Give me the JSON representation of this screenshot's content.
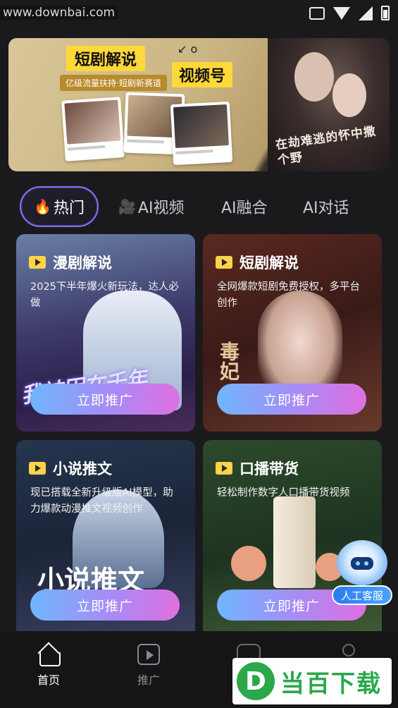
{
  "status_bar": {
    "watermark": "www.downbai.com",
    "icons": [
      "vibrate-icon",
      "wifi-icon",
      "signal-icon",
      "battery-icon"
    ]
  },
  "banner": {
    "title": "短剧解说",
    "title2": "视频号",
    "subtitle": "亿级流量扶持·短剧新赛道",
    "calligraphy": "在劫难逃的怀中撒个野",
    "colors": {
      "yellow": "#ffd83a",
      "gold": "#b88a2b"
    }
  },
  "tabs": [
    {
      "label": "热门",
      "icon": "🔥",
      "active": true
    },
    {
      "label": "AI视频",
      "icon": "🎥",
      "active": false
    },
    {
      "label": "AI融合",
      "active": false
    },
    {
      "label": "AI对话",
      "active": false
    }
  ],
  "cards": [
    {
      "title": "漫剧解说",
      "desc": "2025下半年爆火新玩法，达人必做",
      "cta": "立即推广",
      "art_text": "我被困在千年"
    },
    {
      "title": "短剧解说",
      "desc": "全网爆款短剧免费授权，多平台创作",
      "cta": "立即推广",
      "art_text": "毒妃"
    },
    {
      "title": "小说推文",
      "desc": "现已搭载全新升级版AI模型，助力爆款动漫推文视频创作",
      "cta": "立即推广",
      "art_text": "小说推文"
    },
    {
      "title": "口播带货",
      "desc": "轻松制作数字人口播带货视频",
      "cta": "立即推广",
      "art_text": ""
    }
  ],
  "support": {
    "label": "人工客服"
  },
  "bottom_nav": [
    {
      "label": "首页",
      "icon": "home-icon",
      "active": true
    },
    {
      "label": "推广",
      "icon": "play-icon",
      "active": false
    }
  ],
  "overlay_logo": {
    "letter": "D",
    "text": "当百下载"
  },
  "colors": {
    "accent_purple": "#8d6cf3",
    "cta_start": "#6fb6ff",
    "cta_end": "#e06fe0"
  }
}
